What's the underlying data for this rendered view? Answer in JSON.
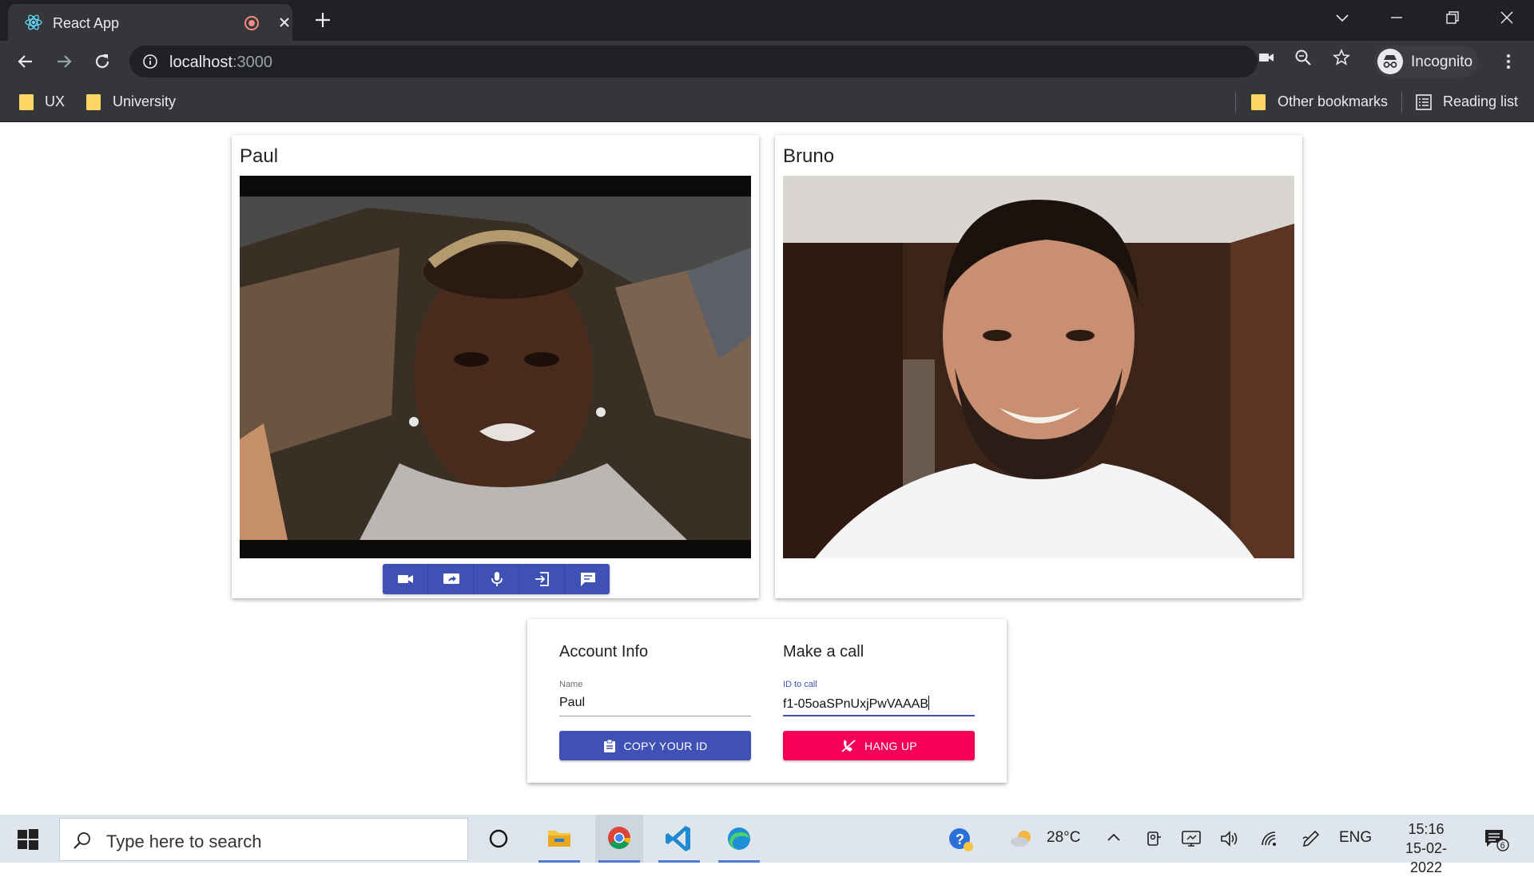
{
  "browser": {
    "tab_title": "React App",
    "url_host": "localhost",
    "url_port": ":3000",
    "profile_label": "Incognito",
    "bookmarks": [
      {
        "label": "UX"
      },
      {
        "label": "University"
      }
    ],
    "other_bookmarks": "Other bookmarks",
    "reading_list": "Reading list"
  },
  "app": {
    "local_video": {
      "name": "Paul"
    },
    "remote_video": {
      "name": "Bruno"
    },
    "controls": [
      {
        "icon": "videocam-icon"
      },
      {
        "icon": "screen-share-icon"
      },
      {
        "icon": "mic-icon"
      },
      {
        "icon": "exit-icon"
      },
      {
        "icon": "chat-icon"
      }
    ],
    "account": {
      "heading": "Account Info",
      "name_label": "Name",
      "name_value": "Paul",
      "copy_button": "COPY YOUR ID"
    },
    "call": {
      "heading": "Make a call",
      "id_label": "ID to call",
      "id_value": "f1-05oaSPnUxjPwVAAAB",
      "hangup_button": "HANG UP"
    },
    "colors": {
      "primary": "#3f51b5",
      "secondary": "#f50057"
    }
  },
  "taskbar": {
    "search_placeholder": "Type here to search",
    "weather": "28°C",
    "language": "ENG",
    "time": "15:16",
    "date": "15-02-2022",
    "notifications": "6"
  }
}
